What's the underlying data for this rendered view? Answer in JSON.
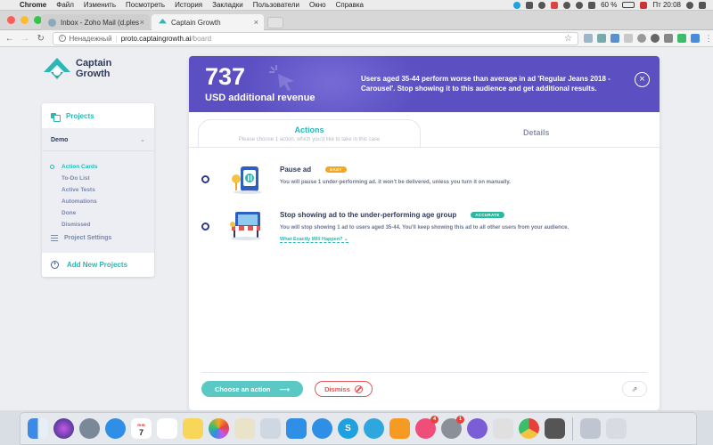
{
  "menubar": {
    "app": "Chrome",
    "items": [
      "Файл",
      "Изменить",
      "Посмотреть",
      "История",
      "Закладки",
      "Пользователи",
      "Окно",
      "Справка"
    ],
    "battery": "60 %",
    "clock": "Пт 20:08"
  },
  "browser": {
    "tabs": [
      {
        "title": "Inbox - Zoho Mail (d.pleshakov",
        "favicon": "zoho-mail-icon"
      },
      {
        "title": "Captain Growth",
        "favicon": "captain-growth-icon"
      }
    ],
    "security_label": "Ненадежный",
    "url_host": "proto.captaingrowth.ai",
    "url_path": "/board"
  },
  "logo": {
    "line1": "Captain",
    "line2": "Growth"
  },
  "sidebar": {
    "projects_label": "Projects",
    "project_name": "Demo",
    "menu": [
      {
        "label": "Action Cards",
        "active": true
      },
      {
        "label": "To-Do List",
        "active": false
      },
      {
        "label": "Active Tests",
        "active": false
      },
      {
        "label": "Automations",
        "active": false
      },
      {
        "label": "Done",
        "active": false
      },
      {
        "label": "Dismissed",
        "active": false
      }
    ],
    "settings_label": "Project Settings",
    "add_label": "Add New Projects"
  },
  "banner": {
    "value": "737",
    "unit": "USD additional revenue",
    "message": "Users aged 35-44 perform worse than average in ad 'Regular Jeans 2018 - Carousel'. Stop showing it to this audience and get additional results."
  },
  "tabs": {
    "actions": "Actions",
    "actions_hint": "Please choose 1 action, which you'd like to take in this case",
    "details": "Details"
  },
  "actions": [
    {
      "title": "Pause ad",
      "badge": "EASY",
      "badge_color": "#f5a623",
      "description": "You will pause 1 under-performing ad. it won't be delivered, unless you turn it on manually.",
      "link": ""
    },
    {
      "title": "Stop showing ad to the under-performing age group",
      "badge": "ACCURATE",
      "badge_color": "#29b8a0",
      "description": "You will stop showing 1 ad to users aged 35-44. You'll keep showing this ad to all other users from your audience.",
      "link": "What Exactly Will Happen?"
    }
  ],
  "footer": {
    "choose": "Choose an action",
    "dismiss": "Dismiss"
  },
  "dock": {
    "calendar_month": "ЯНВ",
    "calendar_day": "7",
    "badges": {
      "itunes": "4",
      "settings": "1"
    }
  },
  "colors": {
    "teal": "#29b8b4",
    "banner": "#5b4fc2",
    "navy": "#2f3a5a",
    "danger": "#e35656"
  }
}
